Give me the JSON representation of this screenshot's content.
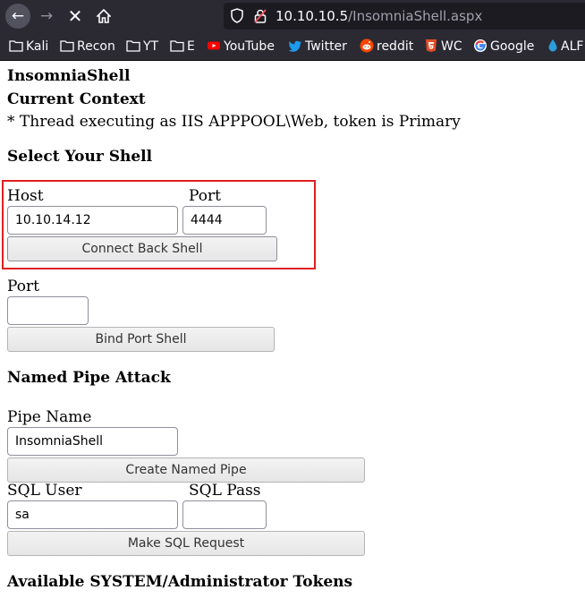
{
  "browser": {
    "url_host": "10.10.10.5",
    "url_path": "/InsomniaShell.aspx",
    "bookmarks": [
      {
        "label": "Kali",
        "icon": "folder-icon"
      },
      {
        "label": "Recon",
        "icon": "folder-icon"
      },
      {
        "label": "YT",
        "icon": "folder-icon"
      },
      {
        "label": "E",
        "icon": "folder-icon"
      },
      {
        "label": "YouTube",
        "icon": "youtube-icon"
      },
      {
        "label": "Twitter",
        "icon": "twitter-icon"
      },
      {
        "label": "reddit",
        "icon": "reddit-icon"
      },
      {
        "label": "WC",
        "icon": "html5-icon"
      },
      {
        "label": "Google",
        "icon": "google-icon"
      },
      {
        "label": "ALF",
        "icon": "drop-icon"
      }
    ]
  },
  "page": {
    "title": "InsomniaShell",
    "context_heading": "Current Context",
    "context_text": "* Thread executing as IIS APPPOOL\\Web, token is Primary",
    "shell_heading": "Select Your Shell",
    "host_label": "Host",
    "port_label": "Port",
    "host_value": "10.10.14.12",
    "port_value": "4444",
    "connect_button": "Connect Back Shell",
    "bind_port_label": "Port",
    "bind_port_value": "",
    "bind_button": "Bind Port Shell",
    "pipe_heading": "Named Pipe Attack",
    "pipe_label": "Pipe Name",
    "pipe_value": "InsomniaShell",
    "pipe_button": "Create Named Pipe",
    "sql_user_label": "SQL User",
    "sql_pass_label": "SQL Pass",
    "sql_user_value": "sa",
    "sql_pass_value": "",
    "sql_button": "Make SQL Request",
    "tokens_heading": "Available SYSTEM/Administrator Tokens"
  },
  "colors": {
    "chrome_bg": "#2b2a33",
    "highlight_border": "#e02020"
  }
}
